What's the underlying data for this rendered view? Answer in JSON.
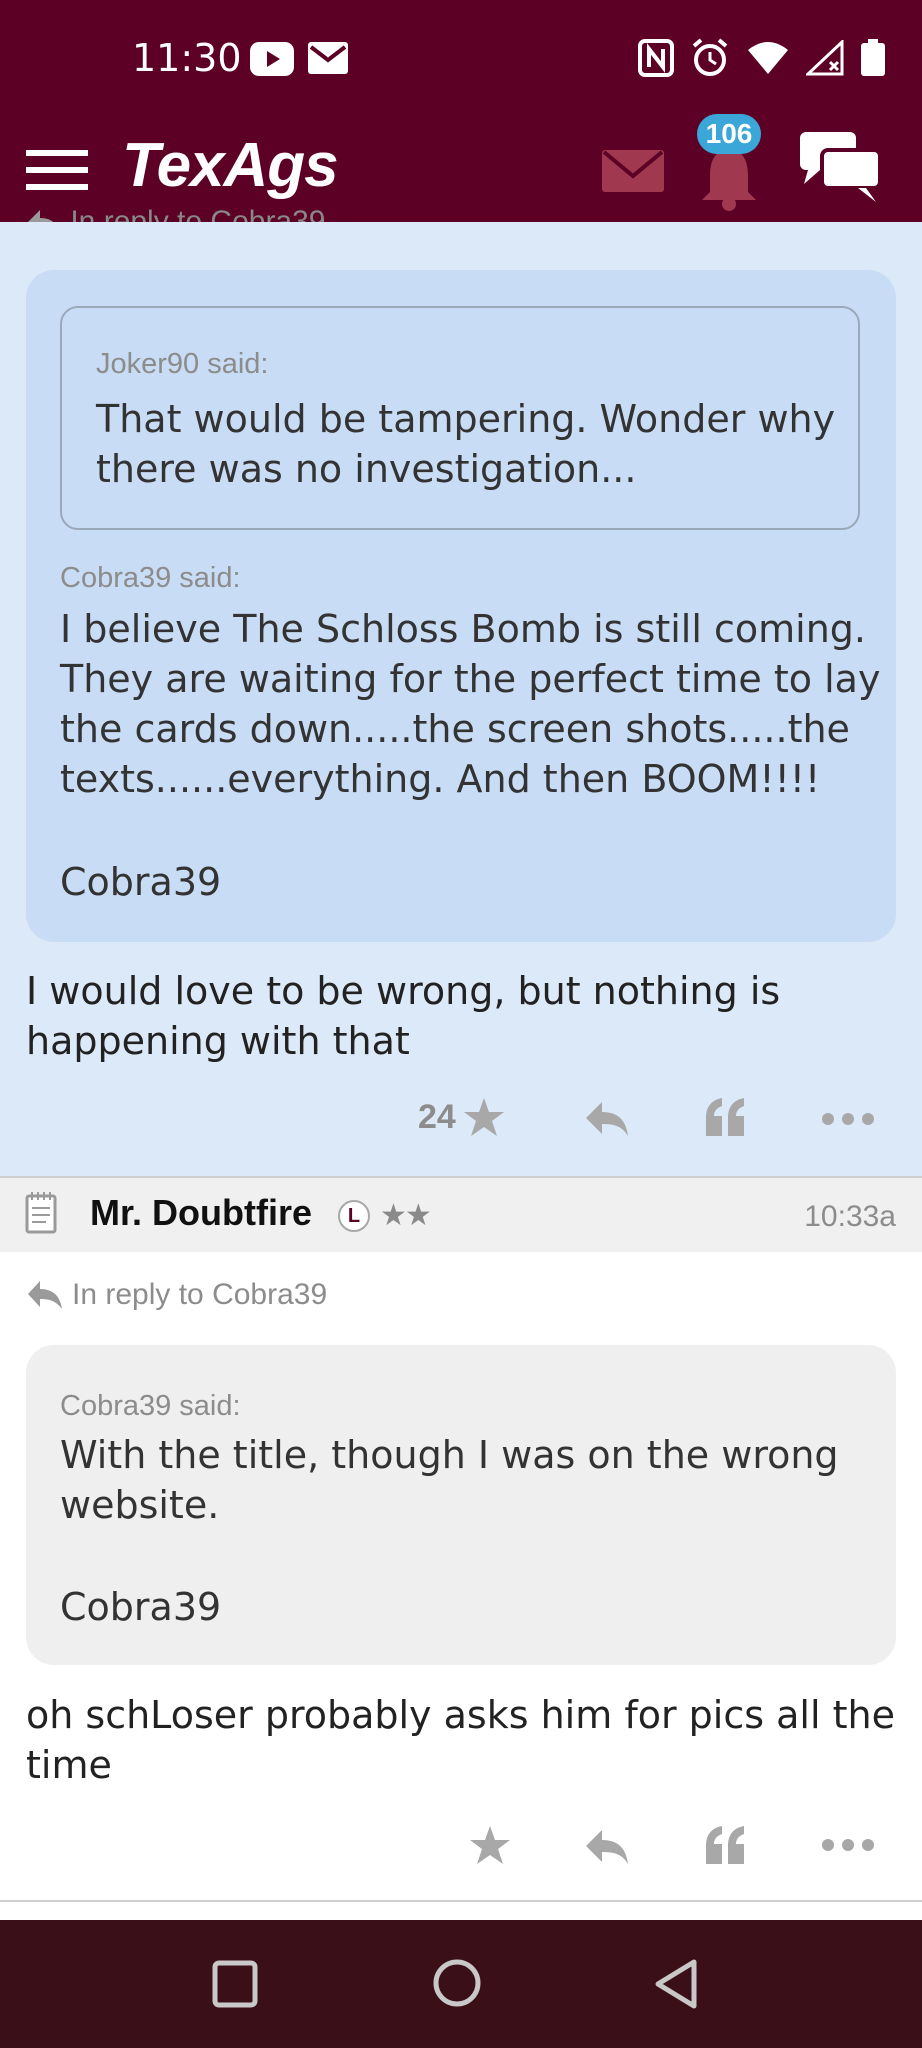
{
  "status_bar": {
    "time": "11:30"
  },
  "app_bar": {
    "logo": "TexAgs",
    "notification_count": "106"
  },
  "post_a": {
    "reply_to_partial": "In reply to Cobra39",
    "inner_quote": {
      "said": "Joker90 said:",
      "text": "That would be tampering. Wonder why there was no investigation..."
    },
    "outer_quote": {
      "said": "Cobra39 said:",
      "lines": [
        "I believe The Schloss Bomb is still coming.",
        "They are waiting for the perfect time to lay",
        "the cards down.....the screen shots.....the",
        "texts......everything. And then BOOM!!!!"
      ],
      "signature": "Cobra39"
    },
    "text_lines": [
      "I would love to be wrong, but nothing is",
      "happening with that"
    ],
    "star_count": "24"
  },
  "post_b": {
    "author": "Mr. Doubtfire",
    "badge": "L",
    "rank_stars": "★★",
    "time": "10:33a",
    "reply_to": "In reply to Cobra39",
    "quote": {
      "said": "Cobra39 said:",
      "lines": [
        "With the title, though I was on the wrong",
        "website."
      ],
      "signature": "Cobra39"
    },
    "text_lines": [
      "oh schLoser probably asks him for pics all the",
      "time"
    ]
  },
  "colors": {
    "brand_maroon": "#5c0025",
    "badge_blue": "#3aa7d8",
    "post_highlight": "#dce9f8",
    "quote_blue": "#c9dcf5",
    "nav_bar": "#3b0f18"
  }
}
